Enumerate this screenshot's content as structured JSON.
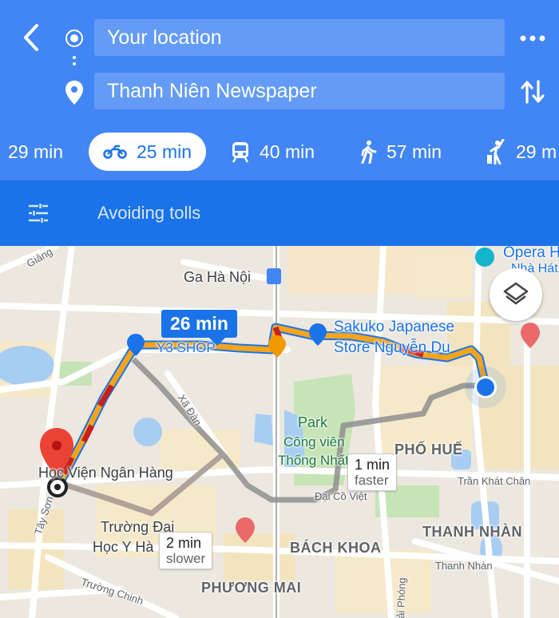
{
  "header": {
    "origin_text": "Your location",
    "destination_text": "Thanh Niên Newspaper",
    "back_icon": "back-arrow-icon",
    "more_icon": "more-horizontal-icon",
    "swap_icon": "swap-vertical-icon"
  },
  "modes": [
    {
      "id": "drive",
      "label": "29 min",
      "icon": "car-icon",
      "active": false
    },
    {
      "id": "motorbike",
      "label": "25 min",
      "icon": "motorbike-icon",
      "active": true
    },
    {
      "id": "transit",
      "label": "40 min",
      "icon": "train-icon",
      "active": false
    },
    {
      "id": "walk",
      "label": "57 min",
      "icon": "walk-icon",
      "active": false
    },
    {
      "id": "ride",
      "label": "29 m",
      "icon": "ride-hail-icon",
      "active": false
    }
  ],
  "options": {
    "label": "Avoiding tolls",
    "icon": "tune-icon"
  },
  "map": {
    "route_time": "26 min",
    "alt_fast": {
      "time": "1 min",
      "desc": "faster"
    },
    "alt_slow": {
      "time": "2 min",
      "desc": "slower"
    },
    "labels": {
      "ga_ha_noi": "Ga Hà Nội",
      "opera_1": "Opera H",
      "opera_2": "Nhà Hát",
      "sakuko_1": "Sakuko Japanese",
      "sakuko_2": "Store Nguyễn Du",
      "y3_shop": "Y3 SHOP",
      "park": "Park",
      "cong_vien": "Công viên",
      "thong_nhat": "Thống Nhất",
      "pho_hue": "PHỐ HUẾ",
      "hoc_vien": "Học Viện Ngân Hàng",
      "tran_khat_chan": "Trần Khát Chân",
      "dai_co_viet": "Đại Cồ Việt",
      "truong_dai_1": "Trường Đại",
      "truong_dai_2": "Học Y Hà",
      "thanh_nhan_area": "THANH NHÀN",
      "bach_khoa": "BÁCH KHOA",
      "thanh_nhan_road": "Thanh Nhàn",
      "phuong_mai": "PHƯƠNG MAI",
      "truong_chinh": "Trường Chinh",
      "giang": "Giảng",
      "xa_dan": "Xã Đàn",
      "tay_son": "Tây Sơn",
      "giai_phong": "Giải Phóng"
    },
    "colors": {
      "route_primary": "#f4a41e",
      "route_slow": "#d93025",
      "route_alt": "#9e9e9e",
      "origin_dot": "#1a73e8",
      "dest_pin": "#ea4335"
    },
    "layers_icon": "layers-icon"
  }
}
